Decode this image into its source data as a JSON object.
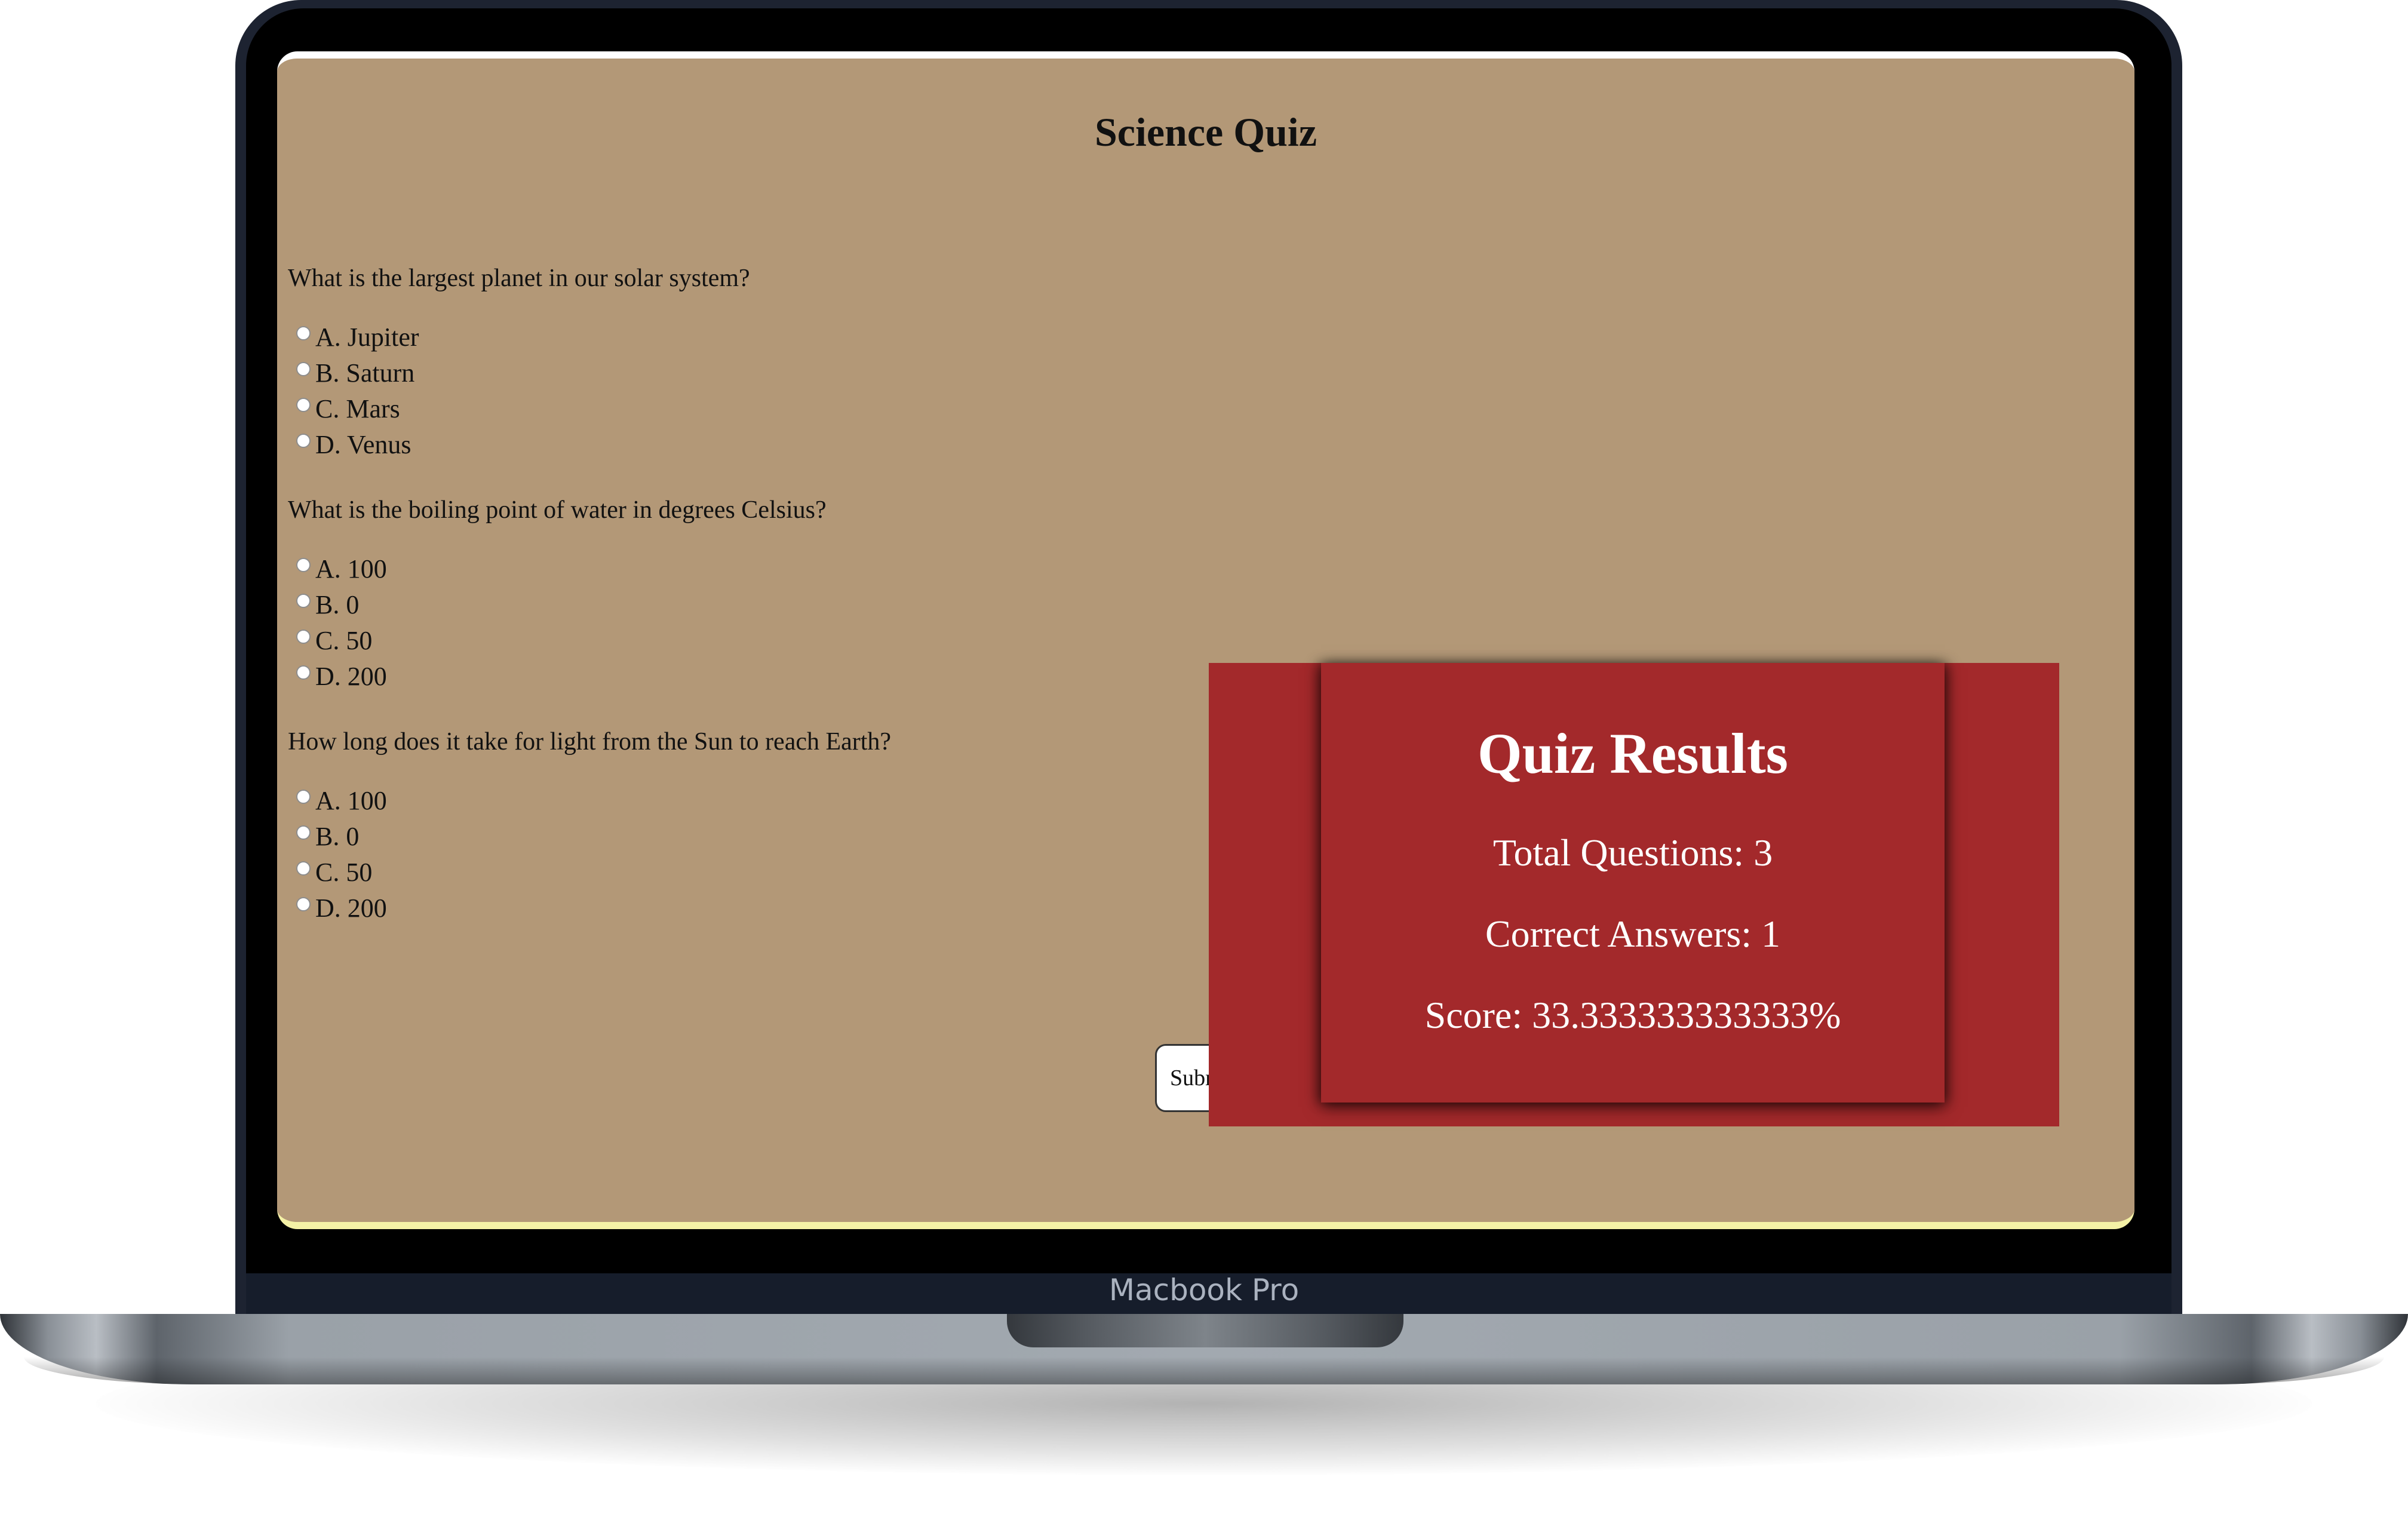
{
  "device": {
    "label": "Macbook Pro"
  },
  "quiz": {
    "title": "Science Quiz",
    "questions": [
      {
        "text": "What is the largest planet in our solar system?",
        "options": [
          "A. Jupiter",
          "B. Saturn",
          "C. Mars",
          "D. Venus"
        ]
      },
      {
        "text": "What is the boiling point of water in degrees Celsius?",
        "options": [
          "A. 100",
          "B. 0",
          "C. 50",
          "D. 200"
        ]
      },
      {
        "text": "How long does it take for light from the Sun to reach Earth?",
        "options": [
          "A. 100",
          "B. 0",
          "C. 50",
          "D. 200"
        ]
      }
    ],
    "submit_label": "Subm"
  },
  "results": {
    "title": "Quiz Results",
    "total_questions": "Total Questions: 3",
    "correct_answers": "Correct Answers: 1",
    "score": "Score: 33.333333333333%"
  },
  "colors": {
    "page_background": "#b39877",
    "results_background": "#a3292b"
  }
}
